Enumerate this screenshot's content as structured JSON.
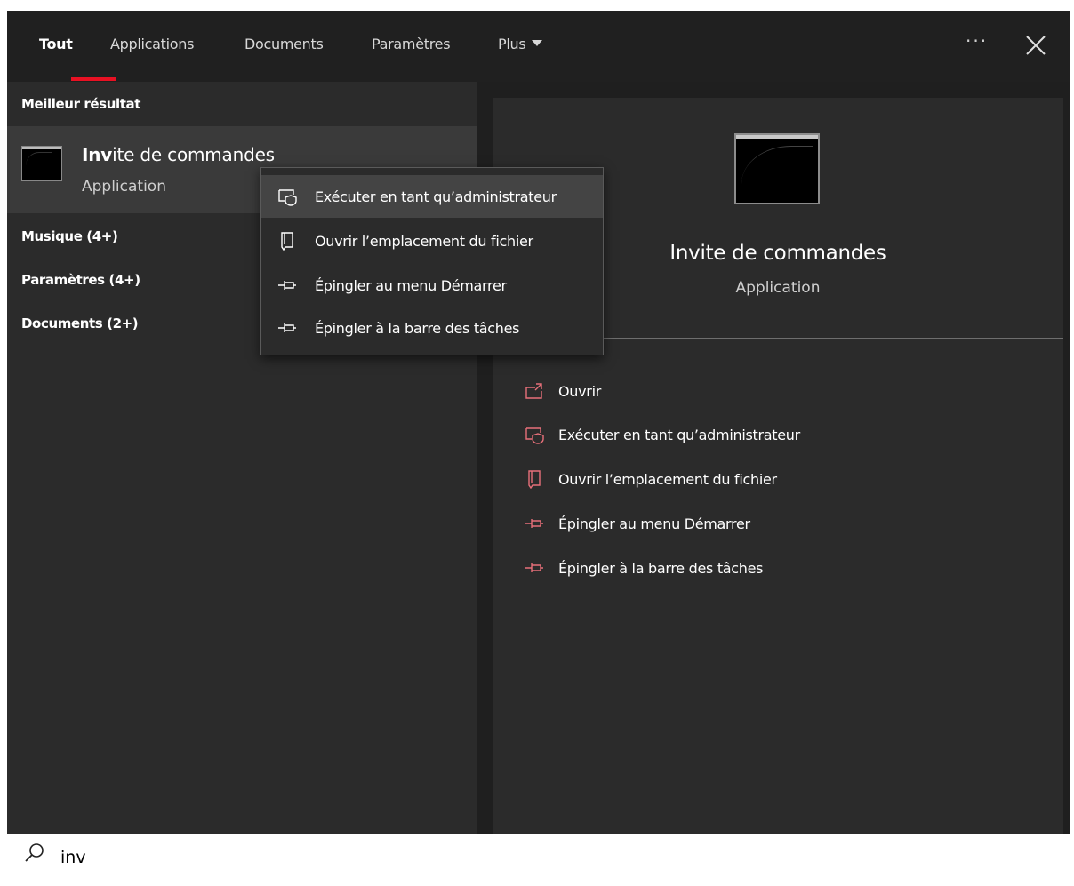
{
  "tabs": [
    {
      "label": "Tout",
      "active": true
    },
    {
      "label": "Applications"
    },
    {
      "label": "Documents"
    },
    {
      "label": "Paramètres"
    },
    {
      "label": "Plus"
    }
  ],
  "more_icon": "ellipsis-icon",
  "close_icon": "close-icon",
  "accent_color": "#e81123",
  "left": {
    "best_heading": "Meilleur résultat",
    "best": {
      "title_match": "Inv",
      "title_rest": "ite de commandes",
      "subtitle": "Application"
    },
    "categories": [
      "Musique (4+)",
      "Paramètres (4+)",
      "Documents (2+)"
    ]
  },
  "context_menu": {
    "items": [
      {
        "label": "Exécuter en tant qu’administrateur",
        "icon": "shield-admin-icon"
      },
      {
        "label": "Ouvrir l’emplacement du fichier",
        "icon": "file-location-icon"
      },
      {
        "label": "Épingler au menu Démarrer",
        "icon": "pin-icon"
      },
      {
        "label": "Épingler à la barre des tâches",
        "icon": "pin-icon"
      }
    ]
  },
  "preview": {
    "title": "Invite de commandes",
    "subtitle": "Application",
    "actions": [
      {
        "label": "Ouvrir",
        "icon": "open-icon"
      },
      {
        "label": "Exécuter en tant qu’administrateur",
        "icon": "shield-admin-icon"
      },
      {
        "label": "Ouvrir l’emplacement du fichier",
        "icon": "file-location-icon"
      },
      {
        "label": "Épingler au menu Démarrer",
        "icon": "pin-icon"
      },
      {
        "label": "Épingler à la barre des tâches",
        "icon": "pin-icon"
      }
    ]
  },
  "search": {
    "value": "inv",
    "icon": "search-icon"
  }
}
